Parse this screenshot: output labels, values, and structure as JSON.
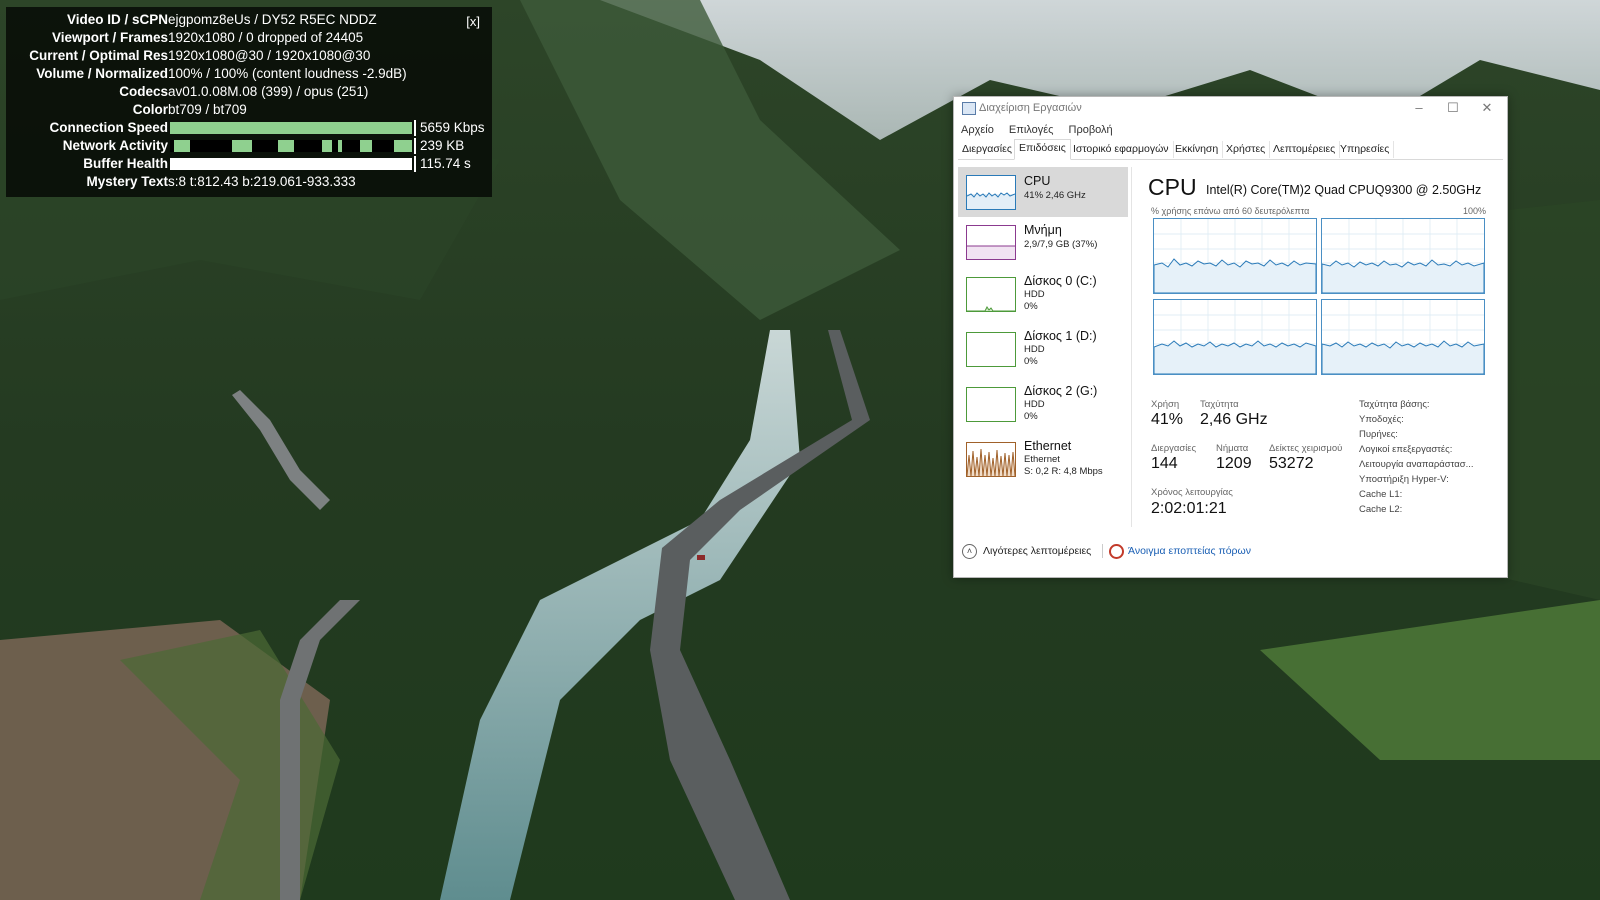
{
  "stats": {
    "close_label": "[x]",
    "rows": [
      {
        "label": "Video ID / sCPN",
        "value": "ejgpomz8eUs / DY52 R5EC NDDZ"
      },
      {
        "label": "Viewport / Frames",
        "value": "1920x1080 / 0 dropped of 24405"
      },
      {
        "label": "Current / Optimal Res",
        "value": "1920x1080@30 / 1920x1080@30"
      },
      {
        "label": "Volume / Normalized",
        "value": "100% / 100% (content loudness -2.9dB)"
      },
      {
        "label": "Codecs",
        "value": "av01.0.08M.08 (399) / opus (251)"
      },
      {
        "label": "Color",
        "value": "bt709 / bt709"
      }
    ],
    "connection_speed": {
      "label": "Connection Speed",
      "value": "5659 Kbps",
      "fill_fraction": 1.0,
      "color": "#8fd08f"
    },
    "network_activity": {
      "label": "Network Activity",
      "value": "239 KB"
    },
    "buffer_health": {
      "label": "Buffer Health",
      "value": "115.74 s",
      "fill_fraction": 1.0,
      "color": "#ffffff"
    },
    "mystery": {
      "label": "Mystery Text",
      "value": "s:8 t:812.43 b:219.061-933.333"
    }
  },
  "taskmanager": {
    "title": "Διαχείριση Εργασιών",
    "window_buttons": {
      "minimize": "–",
      "maximize": "☐",
      "close": "✕"
    },
    "menu": [
      "Αρχείο",
      "Επιλογές",
      "Προβολή"
    ],
    "tabs": [
      "Διεργασίες",
      "Επιδόσεις",
      "Ιστορικό εφαρμογών",
      "Εκκίνηση",
      "Χρήστες",
      "Λεπτομέρειες",
      "Υπηρεσίες"
    ],
    "active_tab": "Επιδόσεις",
    "resources": [
      {
        "name": "CPU",
        "sub1": "41% 2,46 GHz",
        "sub2": "",
        "sub3": "",
        "color": "#2a7ab8"
      },
      {
        "name": "Μνήμη",
        "sub1": "2,9/7,9 GB (37%)",
        "sub2": "",
        "sub3": "",
        "color": "#8b3a8f"
      },
      {
        "name": "Δίσκος 0 (C:)",
        "sub1": "HDD",
        "sub2": "0%",
        "sub3": "",
        "color": "#4d9a3a"
      },
      {
        "name": "Δίσκος 1 (D:)",
        "sub1": "HDD",
        "sub2": "0%",
        "sub3": "",
        "color": "#4d9a3a"
      },
      {
        "name": "Δίσκος 2 (G:)",
        "sub1": "HDD",
        "sub2": "0%",
        "sub3": "",
        "color": "#4d9a3a"
      },
      {
        "name": "Ethernet",
        "sub1": "Ethernet",
        "sub2": "S: 0,2  R: 4,8 Mbps",
        "sub3": "",
        "color": "#a0612a"
      }
    ],
    "detail": {
      "heading": "CPU",
      "model": "Intel(R) Core(TM)2 Quad CPUQ9300 @ 2.50GHz",
      "graph_label": "% χρήσης επάνω από 60 δευτερόλεπτα",
      "graph_max": "100%",
      "usage_label": "Χρήση",
      "usage_value": "41%",
      "speed_label": "Ταχύτητα",
      "speed_value": "2,46 GHz",
      "processes_label": "Διεργασίες",
      "processes_value": "144",
      "threads_label": "Νήματα",
      "threads_value": "1209",
      "handles_label": "Δείκτες χειρισμού",
      "handles_value": "53272",
      "uptime_label": "Χρόνος λειτουργίας",
      "uptime_value": "2:02:01:21",
      "right_labels": [
        "Ταχύτητα βάσης:",
        "Υποδοχές:",
        "Πυρήνες:",
        "Λογικοί επεξεργαστές:",
        "Λειτουργία αναπαράστασ...",
        "Υποστήριξη Hyper-V:",
        "Cache L1:",
        "Cache L2:"
      ]
    },
    "footer": {
      "less_details": "Λιγότερες λεπτομέρειες",
      "open_monitor": "Άνοιγμα εποπτείας πόρων"
    }
  }
}
